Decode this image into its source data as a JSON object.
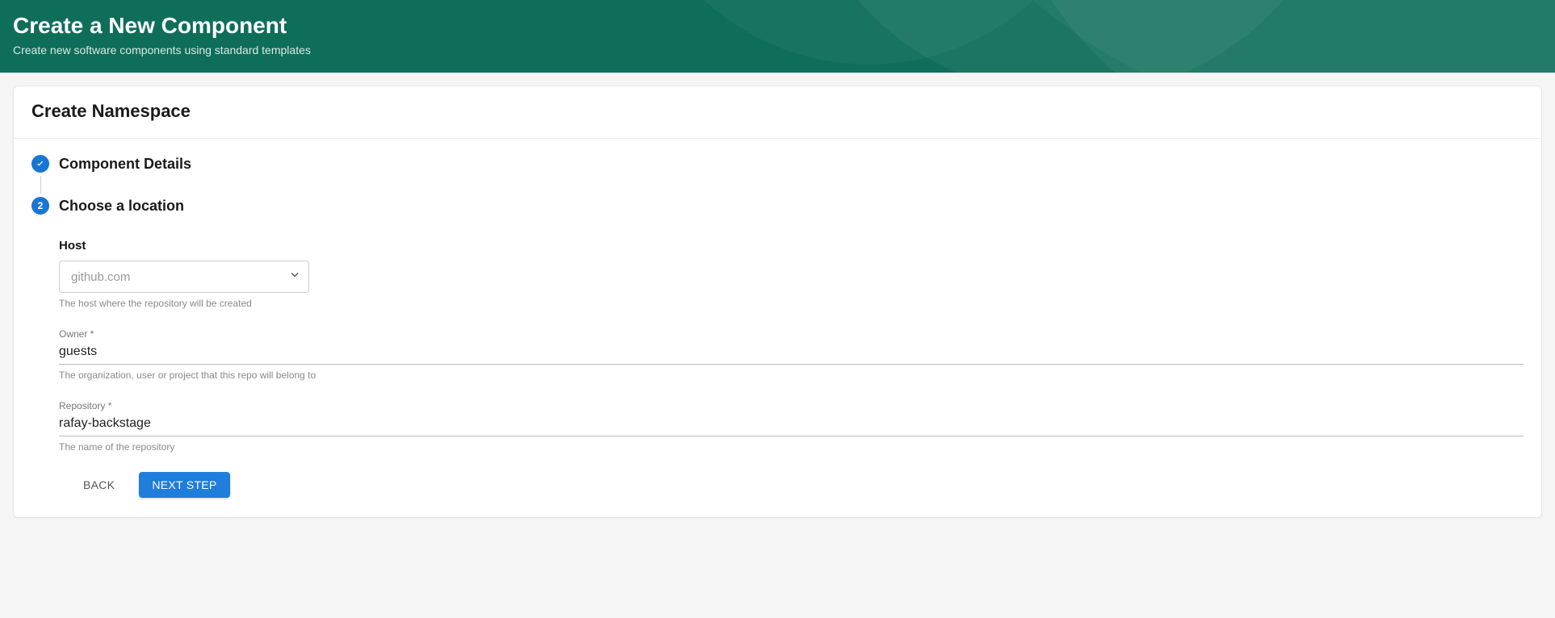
{
  "header": {
    "title": "Create a New Component",
    "subtitle": "Create new software components using standard templates"
  },
  "card": {
    "title": "Create Namespace"
  },
  "stepper": {
    "step1_label": "Component Details",
    "step2_number": "2",
    "step2_label": "Choose a location"
  },
  "form": {
    "host": {
      "label": "Host",
      "value": "github.com",
      "help": "The host where the repository will be created"
    },
    "owner": {
      "label": "Owner *",
      "value": "guests",
      "help": "The organization, user or project that this repo will belong to"
    },
    "repository": {
      "label": "Repository *",
      "value": "rafay-backstage",
      "help": "The name of the repository"
    }
  },
  "buttons": {
    "back": "Back",
    "next": "Next Step"
  }
}
